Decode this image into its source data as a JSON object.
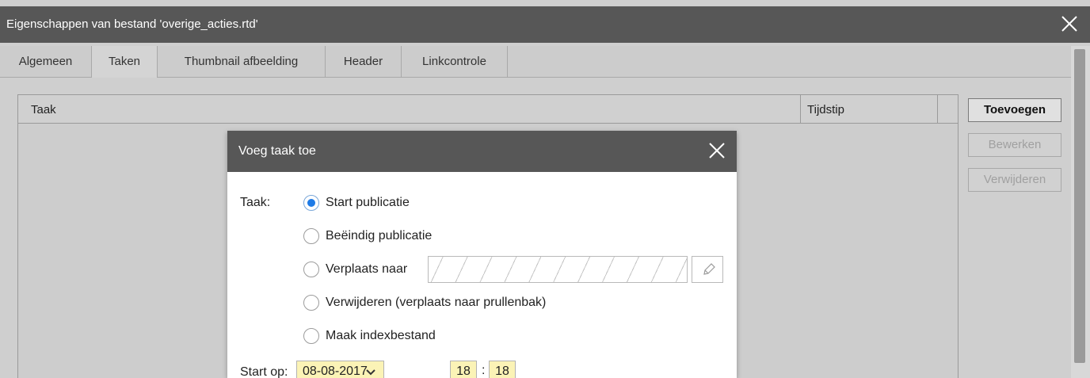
{
  "window": {
    "title": "Eigenschappen van bestand 'overige_acties.rtd'",
    "close_icon": "close-icon",
    "header_color": "#575757"
  },
  "tabs": [
    {
      "label": "Algemeen",
      "active": false
    },
    {
      "label": "Taken",
      "active": true
    },
    {
      "label": "Thumbnail afbeelding",
      "active": false
    },
    {
      "label": "Header",
      "active": false
    },
    {
      "label": "Linkcontrole",
      "active": false
    }
  ],
  "task_table": {
    "columns": [
      "Taak",
      "Tijdstip"
    ],
    "rows": []
  },
  "side_buttons": {
    "add": "Toevoegen",
    "edit": "Bewerken",
    "delete": "Verwijderen"
  },
  "dialog": {
    "title": "Voeg taak toe",
    "task_label": "Taak:",
    "options": [
      {
        "label": "Start publicatie",
        "checked": true
      },
      {
        "label": "Beëindig publicatie",
        "checked": false
      },
      {
        "label": "Verplaats naar",
        "checked": false
      },
      {
        "label": "Verwijderen (verplaats naar prullenbak)",
        "checked": false
      },
      {
        "label": "Maak indexbestand",
        "checked": false
      }
    ],
    "move_target_value": "",
    "start_label": "Start op:",
    "start_date": "08-08-2017",
    "start_hour": "18",
    "start_minute": "18",
    "time_separator": ":",
    "accent_color": "#1e7be6",
    "field_highlight_color": "#fbf3b6"
  }
}
